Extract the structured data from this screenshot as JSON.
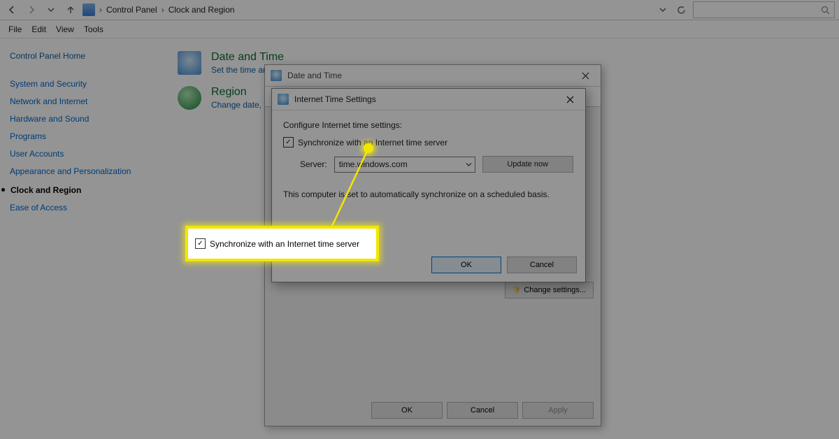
{
  "toolbar": {
    "crumb_root": "Control Panel",
    "crumb_leaf": "Clock and Region"
  },
  "menubar": {
    "file": "File",
    "edit": "Edit",
    "view": "View",
    "tools": "Tools"
  },
  "sidebar": {
    "home": "Control Panel Home",
    "items": [
      "System and Security",
      "Network and Internet",
      "Hardware and Sound",
      "Programs",
      "User Accounts",
      "Appearance and Personalization",
      "Clock and Region",
      "Ease of Access"
    ]
  },
  "content": {
    "dt_title": "Date and Time",
    "dt_link": "Set the time and",
    "rg_title": "Region",
    "rg_link": "Change date, tim"
  },
  "outer": {
    "title": "Date and Time",
    "change_settings": "Change settings...",
    "ok": "OK",
    "cancel": "Cancel",
    "apply": "Apply"
  },
  "inner": {
    "title": "Internet Time Settings",
    "configure": "Configure Internet time settings:",
    "sync_label": "Synchronize with an Internet time server",
    "server_label": "Server:",
    "server_value": "time.windows.com",
    "update_now": "Update now",
    "desc": "This computer is set to automatically synchronize on a scheduled basis.",
    "ok": "OK",
    "cancel": "Cancel"
  },
  "callout": {
    "label": "Synchronize with an Internet time server"
  }
}
